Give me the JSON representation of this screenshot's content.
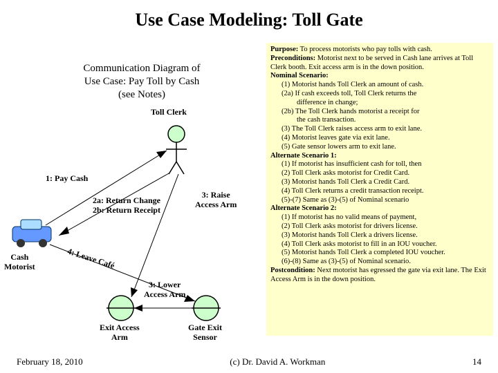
{
  "title": "Use Case Modeling: Toll Gate",
  "subtitle": "Communication Diagram of\nUse Case:  Pay Toll by Cash\n(see Notes)",
  "diagram": {
    "toll_clerk": "Toll Clerk",
    "msg1": "1: Pay Cash",
    "msg2a": "2a: Return Change",
    "msg2b": "2b: Return Receipt",
    "msg3_raise": "3: Raise\nAccess Arm",
    "msg3_lower": "3: Lower\nAccess Arm",
    "msg4": "4: Leave Café",
    "cash_motorist": "Cash\nMotorist",
    "exit_access_arm": "Exit Access\nArm",
    "gate_exit_sensor": "Gate Exit\nSensor"
  },
  "spec": {
    "purpose_label": "Purpose:",
    "purpose": " To process motorists who pay tolls with cash.",
    "preconditions_label": "Preconditions:",
    "preconditions": " Motorist next to be served in Cash lane arrives at Toll Clerk booth.  Exit access arm is in the down position.",
    "nominal_label": "Nominal Scenario:",
    "nominal": [
      "(1)  Motorist hands Toll Clerk an amount of cash.",
      "(2a)  If cash exceeds toll, Toll Clerk returns the",
      "difference in change;",
      "(2b)  The Toll Clerk hands motorist a receipt for",
      "the cash transaction.",
      "(3)   The Toll Clerk raises access arm to exit lane.",
      "(4)   Motorist leaves gate via exit lane.",
      "(5)   Gate sensor lowers arm to exit lane."
    ],
    "alt1_label": "Alternate Scenario 1:",
    "alt1": [
      "(1)   If motorist has insufficient cash for toll, then",
      "(2)  Toll Clerk asks motorist for Credit Card.",
      "(3)  Motorist hands Toll Clerk a Credit Card.",
      "(4)  Toll Clerk returns a credit transaction receipt.",
      "(5)-(7)  Same as (3)-(5) of Nominal scenario"
    ],
    "alt2_label": "Alternate Scenario 2:",
    "alt2": [
      "(1)   If motorist has no valid means of payment,",
      "(2)  Toll Clerk asks motorist for drivers license.",
      "(3)  Motorist hands Toll Clerk a drivers license.",
      "(4)  Toll Clerk asks motorist to fill in an IOU voucher.",
      "(5)    Motorist hands Toll Clerk a completed IOU voucher.",
      "(6)-(8)  Same as (3)-(5) of Nominal scenario."
    ],
    "post_label": "Postcondition:",
    "post": " Next motorist has egressed the gate via exit lane.  The Exit Access Arm is in the down position."
  },
  "footer": {
    "date": "February 18, 2010",
    "copyright": "(c) Dr. David A. Workman",
    "page": "14"
  }
}
